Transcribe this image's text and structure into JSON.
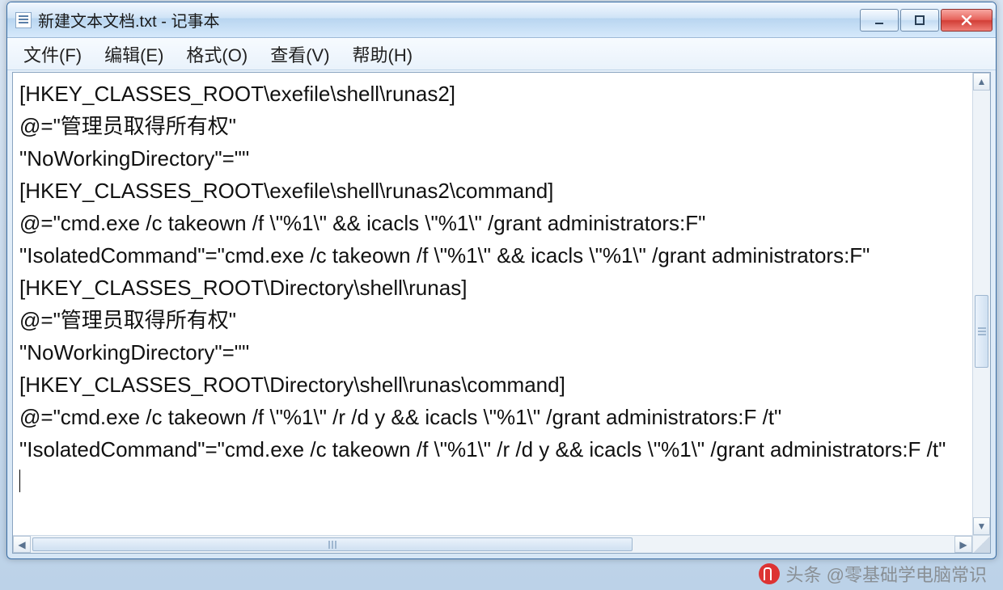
{
  "window": {
    "title": "新建文本文档.txt - 记事本"
  },
  "menu": {
    "file": "文件(F)",
    "edit": "编辑(E)",
    "format": "格式(O)",
    "view": "查看(V)",
    "help": "帮助(H)"
  },
  "editor": {
    "lines": [
      "[HKEY_CLASSES_ROOT\\exefile\\shell\\runas2]",
      "@=\"管理员取得所有权\"",
      "\"NoWorkingDirectory\"=\"\"",
      "[HKEY_CLASSES_ROOT\\exefile\\shell\\runas2\\command]",
      "@=\"cmd.exe /c takeown /f \\\"%1\\\" && icacls \\\"%1\\\" /grant administrators:F\"",
      "\"IsolatedCommand\"=\"cmd.exe /c takeown /f \\\"%1\\\" && icacls \\\"%1\\\" /grant administrators:F\"",
      "[HKEY_CLASSES_ROOT\\Directory\\shell\\runas]",
      "@=\"管理员取得所有权\"",
      "\"NoWorkingDirectory\"=\"\"",
      "[HKEY_CLASSES_ROOT\\Directory\\shell\\runas\\command]",
      "@=\"cmd.exe /c takeown /f \\\"%1\\\" /r /d y && icacls \\\"%1\\\" /grant administrators:F /t\"",
      "\"IsolatedCommand\"=\"cmd.exe /c takeown /f \\\"%1\\\" /r /d y && icacls \\\"%1\\\" /grant administrators:F /t\""
    ]
  },
  "watermark": "头条 @零基础学电脑常识"
}
